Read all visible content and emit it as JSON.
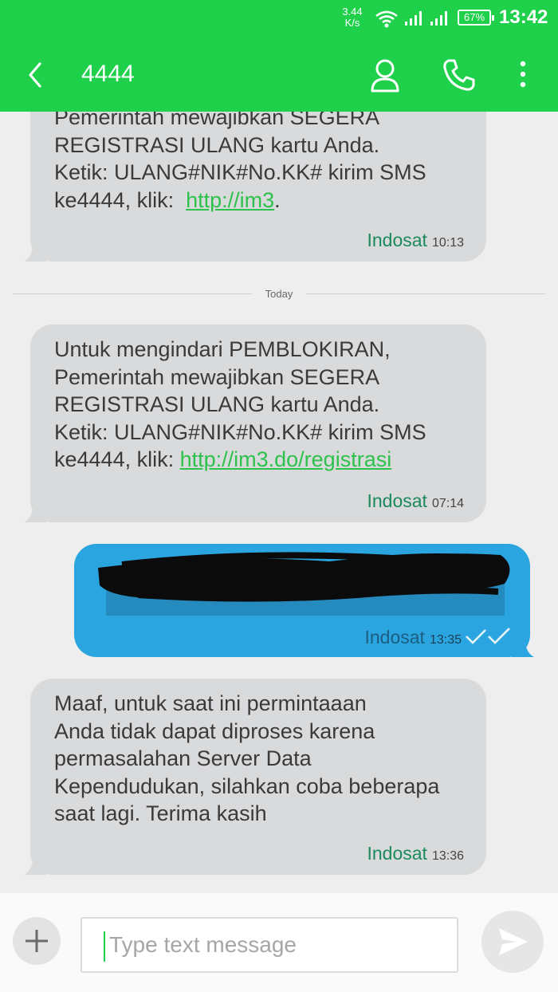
{
  "status_bar": {
    "speed_value": "3.44",
    "speed_unit": "K/s",
    "battery": "67%",
    "time": "13:42"
  },
  "header": {
    "title": "4444",
    "icons": [
      "back-arrow-icon",
      "contact-person-icon",
      "phone-icon",
      "more-vert-icon"
    ]
  },
  "messages": [
    {
      "direction": "incoming",
      "lines": [
        "Pemerintah mewajibkan SEGERA",
        "REGISTRASI ULANG kartu Anda.",
        "Ketik: ULANG#NIK#No.KK# kirim SMS"
      ],
      "last_line_prefix": "ke4444, klik:  ",
      "link": "http://im3",
      "last_line_suffix": ".",
      "sim": "Indosat",
      "time": "10:13"
    },
    {
      "direction": "incoming",
      "lines": [
        "Untuk mengindari PEMBLOKIRAN,",
        "Pemerintah mewajibkan SEGERA",
        "REGISTRASI ULANG kartu Anda.",
        "Ketik: ULANG#NIK#No.KK# kirim SMS"
      ],
      "last_line_prefix": "ke4444, klik: ",
      "link": "http://im3.do/registrasi",
      "last_line_suffix": "",
      "sim": "Indosat",
      "time": "07:14"
    },
    {
      "direction": "outgoing",
      "sim": "Indosat",
      "time": "13:35",
      "redacted": true
    },
    {
      "direction": "incoming",
      "lines": [
        "Maaf, untuk saat ini permintaaan",
        "Anda tidak dapat diproses karena",
        "permasalahan Server Data",
        "Kependudukan, silahkan coba beberapa",
        "saat lagi. Terima kasih"
      ],
      "sim": "Indosat",
      "time": "13:36"
    }
  ],
  "divider_label": "Today",
  "compose": {
    "placeholder": "Type text message"
  },
  "colors": {
    "accent": "#1ed04a",
    "incoming_bubble": "#d9dadc",
    "outgoing_bubble": "#2aa5e0",
    "link": "#2cc24c"
  }
}
